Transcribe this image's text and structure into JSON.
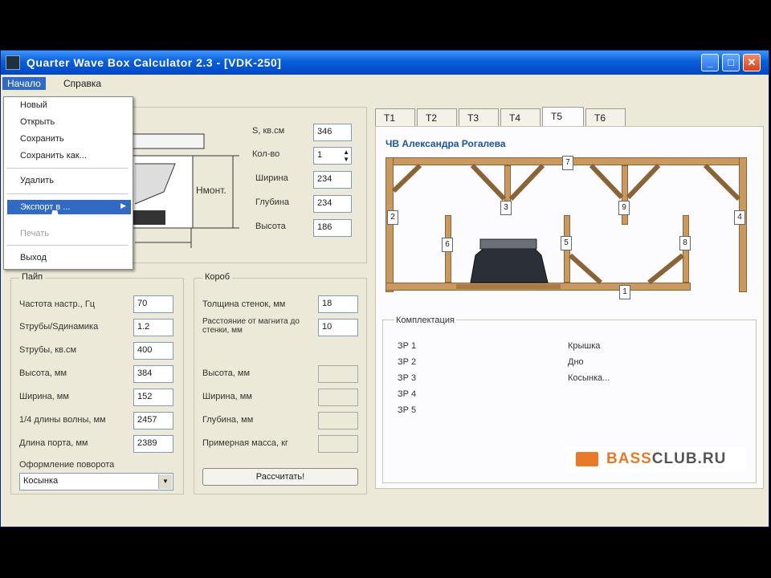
{
  "window": {
    "title": "Quarter Wave Box Calculator 2.3 - [VDK-250]"
  },
  "titlebar_buttons": {
    "minimize": "_",
    "maximize": "□",
    "close": "✕"
  },
  "menu": {
    "file": "Начало",
    "help": "Справка"
  },
  "file_menu": {
    "new": "Новый",
    "open": "Открыть",
    "save": "Сохранить",
    "save_as": "Сохранить как...",
    "delete": "Удалить",
    "export": "Экспорт в ...",
    "print": "Печать",
    "exit": "Выход"
  },
  "speaker_params": {
    "s_label": "S, кв.см",
    "s_value": "346",
    "count_label": "Кол-во",
    "count_value": "1",
    "width_label": "Ширина",
    "width_value": "234",
    "depth_label": "Глубина",
    "depth_value": "234",
    "height_label": "Высота",
    "height_value": "186",
    "dim_label": "Hмонт."
  },
  "pipe_group": {
    "title": "Пайп",
    "tuning_label": "Частота настр., Гц",
    "tuning_value": "70",
    "ratio_label": "Sтрубы/Sдинамика",
    "ratio_value": "1.2",
    "area_label": "Sтрубы, кв.см",
    "area_value": "400",
    "height_label": "Высота, мм",
    "height_value": "384",
    "width_label": "Ширина, мм",
    "width_value": "152",
    "quarter_label": "1/4 длины волны, мм",
    "quarter_value": "2457",
    "length_label": "Длина порта, мм",
    "length_value": "2389",
    "shape_label": "Оформление поворота",
    "shape_value": "Косынка"
  },
  "box_group": {
    "title": "Короб",
    "wall_label": "Толщина стенок, мм",
    "wall_value": "18",
    "gap_label": "Расстояние от магнита до стенки, мм",
    "gap_value": "10",
    "height_label": "Высота, мм",
    "width_label": "Ширина, мм",
    "depth_label": "Глубина, мм",
    "mass_label": "Примерная масса, кг",
    "calc_button": "Рассчитать!"
  },
  "tabs": [
    "T1",
    "T2",
    "T3",
    "T4",
    "T5",
    "T6"
  ],
  "diagram": {
    "title": "ЧВ Александра Рогалева",
    "markers": [
      "1",
      "2",
      "3",
      "4",
      "5",
      "6",
      "7",
      "8",
      "9"
    ]
  },
  "components": {
    "title": "Комплектация",
    "rows": [
      "ЗР 1",
      "ЗР 2",
      "ЗР 3",
      "ЗР 4",
      "ЗР 5"
    ],
    "right_items": [
      "Крышка",
      "Дно",
      "Косынка..."
    ]
  },
  "logo": {
    "left": "BASS",
    "right": "CLUB.RU"
  },
  "colors": {
    "titlebar": "#0a5fd8",
    "wood": "#c89a62",
    "accent": "#e87a2a",
    "link": "#1b54a6"
  }
}
